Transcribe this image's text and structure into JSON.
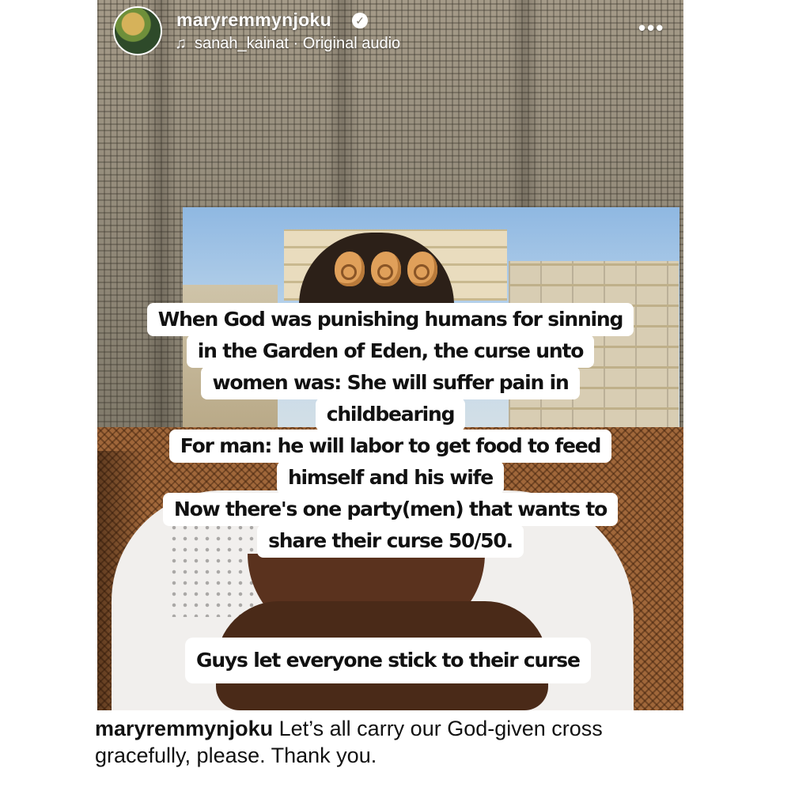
{
  "header": {
    "username": "maryremmynjoku",
    "verified_icon": "verified-badge-icon",
    "audio_credit": "sanah_kainat · Original audio",
    "more_icon": "•••"
  },
  "overlay": {
    "lines": [
      "When God was punishing humans for sinning",
      "in the Garden of Eden, the curse unto",
      "women was:  She will suffer pain in",
      "childbearing",
      "For man: he will labor to get food to feed",
      "himself and his wife",
      "Now there's one party(men) that wants to",
      "share their curse 50/50."
    ],
    "bottom_line": "Guys let everyone stick to their curse"
  },
  "caption": {
    "username": "maryremmynjoku",
    "text": "Let’s all carry our God-given cross gracefully, please. Thank you."
  }
}
